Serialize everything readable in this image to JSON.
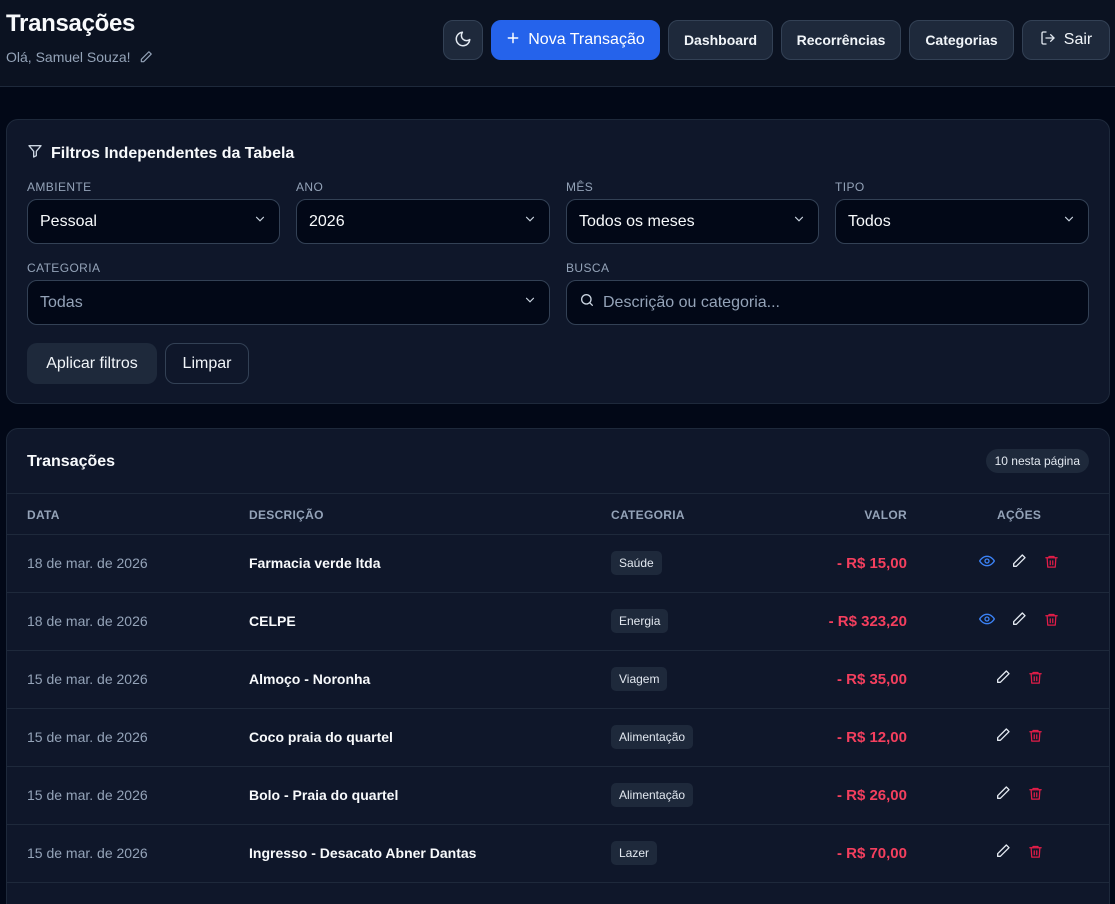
{
  "header": {
    "title": "Transações",
    "greeting": "Olá, Samuel Souza!",
    "buttons": {
      "new_transaction": "Nova Transação",
      "dashboard": "Dashboard",
      "recurrences": "Recorrências",
      "categories": "Categorias",
      "logout": "Sair"
    }
  },
  "filters": {
    "title": "Filtros Independentes da Tabela",
    "environment": {
      "label": "AMBIENTE",
      "value": "Pessoal"
    },
    "year": {
      "label": "ANO",
      "value": "2026"
    },
    "month": {
      "label": "MÊS",
      "value": "Todos os meses"
    },
    "type": {
      "label": "TIPO",
      "value": "Todos"
    },
    "category": {
      "label": "CATEGORIA",
      "value": "Todas"
    },
    "search": {
      "label": "BUSCA",
      "placeholder": "Descrição ou categoria..."
    },
    "apply_label": "Aplicar filtros",
    "clear_label": "Limpar"
  },
  "transactions": {
    "title": "Transações",
    "badge": "10 nesta página",
    "columns": {
      "date": "DATA",
      "description": "DESCRIÇÃO",
      "category": "CATEGORIA",
      "value": "VALOR",
      "actions": "AÇÕES"
    },
    "rows": [
      {
        "date": "18 de mar. de 2026",
        "description": "Farmacia verde ltda",
        "category": "Saúde",
        "value": "- R$ 15,00",
        "viewable": true
      },
      {
        "date": "18 de mar. de 2026",
        "description": "CELPE",
        "category": "Energia",
        "value": "- R$ 323,20",
        "viewable": true
      },
      {
        "date": "15 de mar. de 2026",
        "description": "Almoço - Noronha",
        "category": "Viagem",
        "value": "- R$ 35,00",
        "viewable": false
      },
      {
        "date": "15 de mar. de 2026",
        "description": "Coco praia do quartel",
        "category": "Alimentação",
        "value": "- R$ 12,00",
        "viewable": false
      },
      {
        "date": "15 de mar. de 2026",
        "description": "Bolo - Praia do quartel",
        "category": "Alimentação",
        "value": "- R$ 26,00",
        "viewable": false
      },
      {
        "date": "15 de mar. de 2026",
        "description": "Ingresso - Desacato Abner Dantas",
        "category": "Lazer",
        "value": "- R$ 70,00",
        "viewable": false
      }
    ]
  },
  "colors": {
    "primary": "#2563eb",
    "expense": "#f43f5e",
    "view_icon": "#3b82f6",
    "delete_icon": "#e11d48"
  },
  "icons": [
    "moon-icon",
    "plus-icon",
    "logout-icon",
    "pencil-icon",
    "filter-icon",
    "chevron-down-icon",
    "search-icon",
    "eye-icon",
    "trash-icon"
  ]
}
